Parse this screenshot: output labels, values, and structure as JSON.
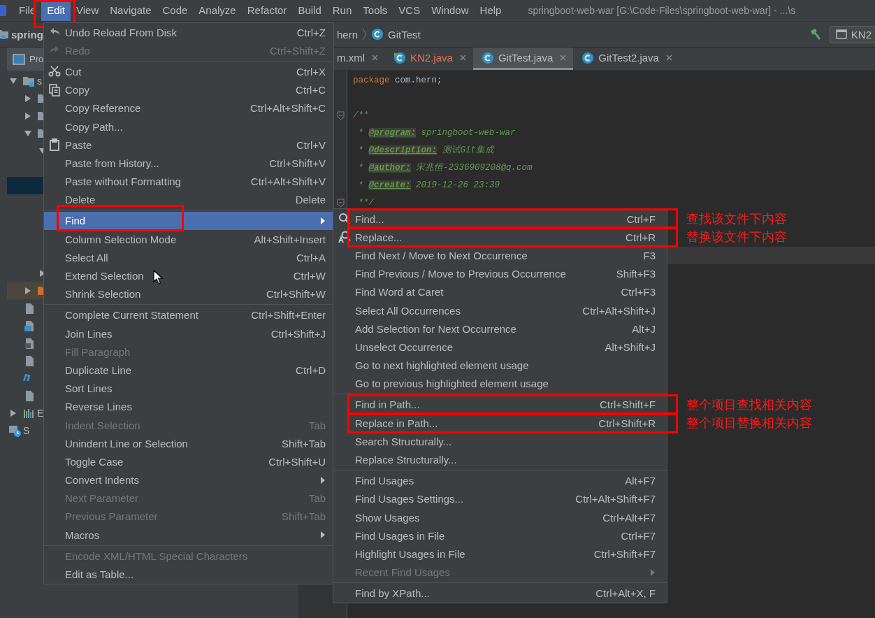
{
  "menubar": {
    "items": [
      {
        "label": "File",
        "selected": false,
        "annotated": false
      },
      {
        "label": "Edit",
        "selected": true,
        "annotated": true
      },
      {
        "label": "View",
        "selected": false,
        "annotated": false
      },
      {
        "label": "Navigate",
        "selected": false,
        "annotated": false
      },
      {
        "label": "Code",
        "selected": false,
        "annotated": false
      },
      {
        "label": "Analyze",
        "selected": false,
        "annotated": false
      },
      {
        "label": "Refactor",
        "selected": false,
        "annotated": false
      },
      {
        "label": "Build",
        "selected": false,
        "annotated": false
      },
      {
        "label": "Run",
        "selected": false,
        "annotated": false
      },
      {
        "label": "Tools",
        "selected": false,
        "annotated": false
      },
      {
        "label": "VCS",
        "selected": false,
        "annotated": false
      },
      {
        "label": "Window",
        "selected": false,
        "annotated": false
      },
      {
        "label": "Help",
        "selected": false,
        "annotated": false
      }
    ],
    "title": "springboot-web-war [G:\\Code-Files\\springboot-web-war] - ...\\s"
  },
  "toolbar": {
    "project": "spring",
    "breadcrumb": [
      "hern",
      "GitTest"
    ],
    "run_config": "KN2"
  },
  "project_panel": {
    "tab": "Pro",
    "tree": [
      {
        "kind": "module",
        "label": "s",
        "expanded": true,
        "children": [
          {
            "kind": "folder",
            "expanded": false
          },
          {
            "kind": "folder",
            "expanded": false
          },
          {
            "kind": "folder",
            "expanded": true,
            "children": [
              {
                "expanded": true,
                "children": [
                  {
                    "selected": false
                  },
                  {
                    "selected": true
                  },
                  {
                    "selected": false
                  },
                  {
                    "selected": false
                  },
                  {
                    "selected": false
                  },
                  {
                    "selected": false
                  }
                ]
              },
              {
                "expanded": false
              }
            ]
          },
          {
            "kind": "excluded-folder",
            "expanded": false
          },
          {
            "kind": "file"
          },
          {
            "kind": "maven-file"
          },
          {
            "kind": "xml-file"
          },
          {
            "kind": "file"
          },
          {
            "kind": "markdown-file"
          },
          {
            "kind": "file"
          }
        ]
      },
      {
        "kind": "libraries",
        "label": "E",
        "expanded": false
      },
      {
        "kind": "scratches",
        "label": "S"
      }
    ]
  },
  "editor": {
    "tabs": [
      {
        "label": "m.xml",
        "selected": false,
        "has_errors": false
      },
      {
        "label": "KN2.java",
        "kind": "runnable-class",
        "selected": false,
        "has_errors": true
      },
      {
        "label": "GitTest.java",
        "kind": "class",
        "selected": true,
        "has_errors": false
      },
      {
        "label": "GitTest2.java",
        "kind": "class",
        "selected": false,
        "has_errors": false
      }
    ],
    "lines": [
      {
        "kind": "code",
        "segments": [
          {
            "kind": "keyword",
            "text": "package"
          },
          {
            "kind": "plain",
            "text": " com.hern;"
          }
        ]
      },
      {
        "kind": "blank"
      },
      {
        "kind": "code",
        "fold": true,
        "segments": [
          {
            "kind": "doc",
            "text": "/**"
          }
        ]
      },
      {
        "kind": "code",
        "segments": [
          {
            "kind": "doc",
            "text": " * "
          },
          {
            "kind": "doc-tag",
            "text": "@program:"
          },
          {
            "kind": "doc",
            "text": " springboot-web-war"
          }
        ]
      },
      {
        "kind": "code",
        "segments": [
          {
            "kind": "doc",
            "text": " * "
          },
          {
            "kind": "doc-tag",
            "text": "@description:"
          },
          {
            "kind": "doc",
            "text": " 测试Git集成"
          }
        ]
      },
      {
        "kind": "code",
        "segments": [
          {
            "kind": "doc",
            "text": " * "
          },
          {
            "kind": "doc-tag",
            "text": "@author:"
          },
          {
            "kind": "doc",
            "text": " 宋兆恒-2336909208@q.com"
          }
        ]
      },
      {
        "kind": "code",
        "segments": [
          {
            "kind": "doc",
            "text": " * "
          },
          {
            "kind": "doc-tag",
            "text": "@create:"
          },
          {
            "kind": "doc",
            "text": " 2019-12-26 23:39"
          }
        ]
      },
      {
        "kind": "code",
        "fold": true,
        "segments": [
          {
            "kind": "doc",
            "text": " **/"
          }
        ]
      },
      {
        "kind": "blank"
      },
      {
        "kind": "blank"
      },
      {
        "kind": "blank",
        "current": true
      }
    ]
  },
  "edit_menu": {
    "groups": [
      [
        {
          "label": "Undo Reload From Disk",
          "shortcut": "Ctrl+Z",
          "kind": "undo",
          "disabled": false
        },
        {
          "label": "Redo",
          "shortcut": "Ctrl+Shift+Z",
          "kind": "redo",
          "disabled": true
        }
      ],
      [
        {
          "label": "Cut",
          "shortcut": "Ctrl+X",
          "kind": "cut",
          "disabled": false
        },
        {
          "label": "Copy",
          "shortcut": "Ctrl+C",
          "kind": "copy",
          "disabled": false
        },
        {
          "label": "Copy Reference",
          "shortcut": "Ctrl+Alt+Shift+C",
          "disabled": false
        },
        {
          "label": "Copy Path...",
          "disabled": false
        },
        {
          "label": "Paste",
          "shortcut": "Ctrl+V",
          "kind": "paste",
          "disabled": false
        },
        {
          "label": "Paste from History...",
          "shortcut": "Ctrl+Shift+V",
          "disabled": false
        },
        {
          "label": "Paste without Formatting",
          "shortcut": "Ctrl+Alt+Shift+V",
          "disabled": false
        },
        {
          "label": "Delete",
          "shortcut": "Delete",
          "disabled": false
        }
      ],
      [
        {
          "label": "Find",
          "has_submenu": true,
          "selected": true,
          "annotated": true,
          "disabled": false
        },
        {
          "label": "Column Selection Mode",
          "shortcut": "Alt+Shift+Insert",
          "disabled": false
        },
        {
          "label": "Select All",
          "shortcut": "Ctrl+A",
          "disabled": false
        },
        {
          "label": "Extend Selection",
          "shortcut": "Ctrl+W",
          "disabled": false
        },
        {
          "label": "Shrink Selection",
          "shortcut": "Ctrl+Shift+W",
          "disabled": false
        }
      ],
      [
        {
          "label": "Complete Current Statement",
          "shortcut": "Ctrl+Shift+Enter",
          "disabled": false
        },
        {
          "label": "Join Lines",
          "shortcut": "Ctrl+Shift+J",
          "disabled": false
        },
        {
          "label": "Fill Paragraph",
          "disabled": true
        },
        {
          "label": "Duplicate Line",
          "shortcut": "Ctrl+D",
          "disabled": false
        },
        {
          "label": "Sort Lines",
          "disabled": false
        },
        {
          "label": "Reverse Lines",
          "disabled": false
        },
        {
          "label": "Indent Selection",
          "shortcut": "Tab",
          "disabled": true
        },
        {
          "label": "Unindent Line or Selection",
          "shortcut": "Shift+Tab",
          "disabled": false
        },
        {
          "label": "Toggle Case",
          "shortcut": "Ctrl+Shift+U",
          "disabled": false
        },
        {
          "label": "Convert Indents",
          "has_submenu": true,
          "disabled": false
        },
        {
          "label": "Next Parameter",
          "shortcut": "Tab",
          "disabled": true
        },
        {
          "label": "Previous Parameter",
          "shortcut": "Shift+Tab",
          "disabled": true
        },
        {
          "label": "Macros",
          "has_submenu": true,
          "disabled": false
        }
      ],
      [
        {
          "label": "Encode XML/HTML Special Characters",
          "disabled": true
        },
        {
          "label": "Edit as Table...",
          "disabled": false
        }
      ]
    ]
  },
  "find_submenu": {
    "groups": [
      [
        {
          "label": "Find...",
          "shortcut": "Ctrl+F",
          "kind": "search",
          "annotated": true,
          "note": "查找该文件下内容",
          "disabled": false
        },
        {
          "label": "Replace...",
          "shortcut": "Ctrl+R",
          "kind": "replace",
          "annotated": true,
          "note": "替换该文件下内容",
          "disabled": false
        },
        {
          "label": "Find Next / Move to Next Occurrence",
          "shortcut": "F3",
          "disabled": false
        },
        {
          "label": "Find Previous / Move to Previous Occurrence",
          "shortcut": "Shift+F3",
          "disabled": false
        },
        {
          "label": "Find Word at Caret",
          "shortcut": "Ctrl+F3",
          "disabled": false
        },
        {
          "label": "Select All Occurrences",
          "shortcut": "Ctrl+Alt+Shift+J",
          "disabled": false
        },
        {
          "label": "Add Selection for Next Occurrence",
          "shortcut": "Alt+J",
          "disabled": false
        },
        {
          "label": "Unselect Occurrence",
          "shortcut": "Alt+Shift+J",
          "disabled": false
        },
        {
          "label": "Go to next highlighted element usage",
          "disabled": false
        },
        {
          "label": "Go to previous highlighted element usage",
          "disabled": false
        }
      ],
      [
        {
          "label": "Find in Path...",
          "shortcut": "Ctrl+Shift+F",
          "annotated": true,
          "note": "整个项目查找相关内容",
          "disabled": false
        },
        {
          "label": "Replace in Path...",
          "shortcut": "Ctrl+Shift+R",
          "annotated": true,
          "note": "整个项目替换相关内容",
          "disabled": false
        },
        {
          "label": "Search Structurally...",
          "disabled": false
        },
        {
          "label": "Replace Structurally...",
          "disabled": false
        }
      ],
      [
        {
          "label": "Find Usages",
          "shortcut": "Alt+F7",
          "disabled": false
        },
        {
          "label": "Find Usages Settings...",
          "shortcut": "Ctrl+Alt+Shift+F7",
          "disabled": false
        },
        {
          "label": "Show Usages",
          "shortcut": "Ctrl+Alt+F7",
          "disabled": false
        },
        {
          "label": "Find Usages in File",
          "shortcut": "Ctrl+F7",
          "disabled": false
        },
        {
          "label": "Highlight Usages in File",
          "shortcut": "Ctrl+Shift+F7",
          "disabled": false
        },
        {
          "label": "Recent Find Usages",
          "has_submenu": true,
          "disabled": true
        }
      ],
      [
        {
          "label": "Find by XPath...",
          "shortcut": "Ctrl+Alt+X, F",
          "disabled": false
        }
      ]
    ]
  }
}
